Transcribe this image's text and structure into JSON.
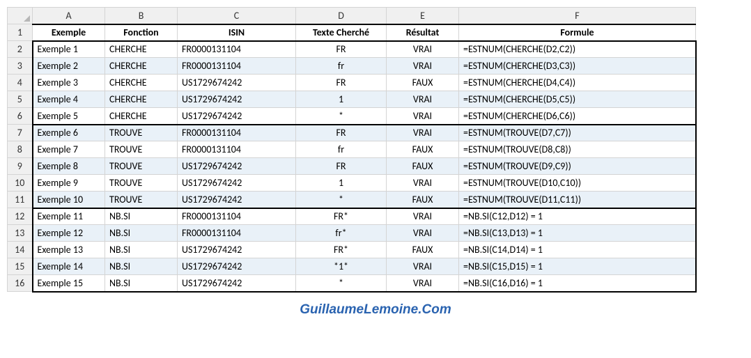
{
  "columns": [
    "A",
    "B",
    "C",
    "D",
    "E",
    "F"
  ],
  "headers": {
    "A": "Exemple",
    "B": "Fonction",
    "C": "ISIN",
    "D": "Texte Cherché",
    "E": "Résultat",
    "F": "Formule"
  },
  "rows": [
    {
      "n": 2,
      "A": "Exemple 1",
      "B": "CHERCHE",
      "C": "FR0000131104",
      "D": "FR",
      "E": "VRAI",
      "F": "=ESTNUM(CHERCHE(D2,C2))",
      "alt": false,
      "group_top": true
    },
    {
      "n": 3,
      "A": "Exemple 2",
      "B": "CHERCHE",
      "C": "FR0000131104",
      "D": "fr",
      "E": "VRAI",
      "F": "=ESTNUM(CHERCHE(D3,C3))",
      "alt": true
    },
    {
      "n": 4,
      "A": "Exemple 3",
      "B": "CHERCHE",
      "C": "US1729674242",
      "D": "FR",
      "E": "FAUX",
      "F": "=ESTNUM(CHERCHE(D4,C4))",
      "alt": false
    },
    {
      "n": 5,
      "A": "Exemple 4",
      "B": "CHERCHE",
      "C": "US1729674242",
      "D": "1",
      "E": "VRAI",
      "F": "=ESTNUM(CHERCHE(D5,C5))",
      "alt": true
    },
    {
      "n": 6,
      "A": "Exemple 5",
      "B": "CHERCHE",
      "C": "US1729674242",
      "D": "*",
      "E": "VRAI",
      "F": "=ESTNUM(CHERCHE(D6,C6))",
      "alt": false,
      "group_bot": true
    },
    {
      "n": 7,
      "A": "Exemple 6",
      "B": "TROUVE",
      "C": "FR0000131104",
      "D": "FR",
      "E": "VRAI",
      "F": "=ESTNUM(TROUVE(D7,C7))",
      "alt": true,
      "group_top": true
    },
    {
      "n": 8,
      "A": "Exemple 7",
      "B": "TROUVE",
      "C": "FR0000131104",
      "D": "fr",
      "E": "FAUX",
      "F": "=ESTNUM(TROUVE(D8,C8))",
      "alt": false
    },
    {
      "n": 9,
      "A": "Exemple 8",
      "B": "TROUVE",
      "C": "US1729674242",
      "D": "FR",
      "E": "FAUX",
      "F": "=ESTNUM(TROUVE(D9,C9))",
      "alt": true
    },
    {
      "n": 10,
      "A": "Exemple 9",
      "B": "TROUVE",
      "C": "US1729674242",
      "D": "1",
      "E": "VRAI",
      "F": "=ESTNUM(TROUVE(D10,C10))",
      "alt": false
    },
    {
      "n": 11,
      "A": "Exemple 10",
      "B": "TROUVE",
      "C": "US1729674242",
      "D": "*",
      "E": "FAUX",
      "F": "=ESTNUM(TROUVE(D11,C11))",
      "alt": true,
      "group_bot": true
    },
    {
      "n": 12,
      "A": "Exemple 11",
      "B": "NB.SI",
      "C": "FR0000131104",
      "D": "FR*",
      "E": "VRAI",
      "F": "=NB.SI(C12,D12) = 1",
      "alt": false,
      "group_top": true
    },
    {
      "n": 13,
      "A": "Exemple 12",
      "B": "NB.SI",
      "C": "FR0000131104",
      "D": "fr*",
      "E": "VRAI",
      "F": "=NB.SI(C13,D13) = 1",
      "alt": true
    },
    {
      "n": 14,
      "A": "Exemple 13",
      "B": "NB.SI",
      "C": "US1729674242",
      "D": "FR*",
      "E": "FAUX",
      "F": "=NB.SI(C14,D14) = 1",
      "alt": false
    },
    {
      "n": 15,
      "A": "Exemple 14",
      "B": "NB.SI",
      "C": "US1729674242",
      "D": "*1*",
      "E": "VRAI",
      "F": "=NB.SI(C15,D15) = 1",
      "alt": true
    },
    {
      "n": 16,
      "A": "Exemple 15",
      "B": "NB.SI",
      "C": "US1729674242",
      "D": "*",
      "E": "VRAI",
      "F": "=NB.SI(C16,D16) = 1",
      "alt": false,
      "group_bot": true
    }
  ],
  "watermark": "GuillaumeLemoine.Com",
  "chart_data": {
    "type": "table",
    "title": "Excel CHERCHE / TROUVE / NB.SI comparison",
    "columns": [
      "Exemple",
      "Fonction",
      "ISIN",
      "Texte Cherché",
      "Résultat",
      "Formule"
    ],
    "rows": [
      [
        "Exemple 1",
        "CHERCHE",
        "FR0000131104",
        "FR",
        "VRAI",
        "=ESTNUM(CHERCHE(D2,C2))"
      ],
      [
        "Exemple 2",
        "CHERCHE",
        "FR0000131104",
        "fr",
        "VRAI",
        "=ESTNUM(CHERCHE(D3,C3))"
      ],
      [
        "Exemple 3",
        "CHERCHE",
        "US1729674242",
        "FR",
        "FAUX",
        "=ESTNUM(CHERCHE(D4,C4))"
      ],
      [
        "Exemple 4",
        "CHERCHE",
        "US1729674242",
        "1",
        "VRAI",
        "=ESTNUM(CHERCHE(D5,C5))"
      ],
      [
        "Exemple 5",
        "CHERCHE",
        "US1729674242",
        "*",
        "VRAI",
        "=ESTNUM(CHERCHE(D6,C6))"
      ],
      [
        "Exemple 6",
        "TROUVE",
        "FR0000131104",
        "FR",
        "VRAI",
        "=ESTNUM(TROUVE(D7,C7))"
      ],
      [
        "Exemple 7",
        "TROUVE",
        "FR0000131104",
        "fr",
        "FAUX",
        "=ESTNUM(TROUVE(D8,C8))"
      ],
      [
        "Exemple 8",
        "TROUVE",
        "US1729674242",
        "FR",
        "FAUX",
        "=ESTNUM(TROUVE(D9,C9))"
      ],
      [
        "Exemple 9",
        "TROUVE",
        "US1729674242",
        "1",
        "VRAI",
        "=ESTNUM(TROUVE(D10,C10))"
      ],
      [
        "Exemple 10",
        "TROUVE",
        "US1729674242",
        "*",
        "FAUX",
        "=ESTNUM(TROUVE(D11,C11))"
      ],
      [
        "Exemple 11",
        "NB.SI",
        "FR0000131104",
        "FR*",
        "VRAI",
        "=NB.SI(C12,D12) = 1"
      ],
      [
        "Exemple 12",
        "NB.SI",
        "FR0000131104",
        "fr*",
        "VRAI",
        "=NB.SI(C13,D13) = 1"
      ],
      [
        "Exemple 13",
        "NB.SI",
        "US1729674242",
        "FR*",
        "FAUX",
        "=NB.SI(C14,D14) = 1"
      ],
      [
        "Exemple 14",
        "NB.SI",
        "US1729674242",
        "*1*",
        "VRAI",
        "=NB.SI(C15,D15) = 1"
      ],
      [
        "Exemple 15",
        "NB.SI",
        "US1729674242",
        "*",
        "VRAI",
        "=NB.SI(C16,D16) = 1"
      ]
    ]
  }
}
